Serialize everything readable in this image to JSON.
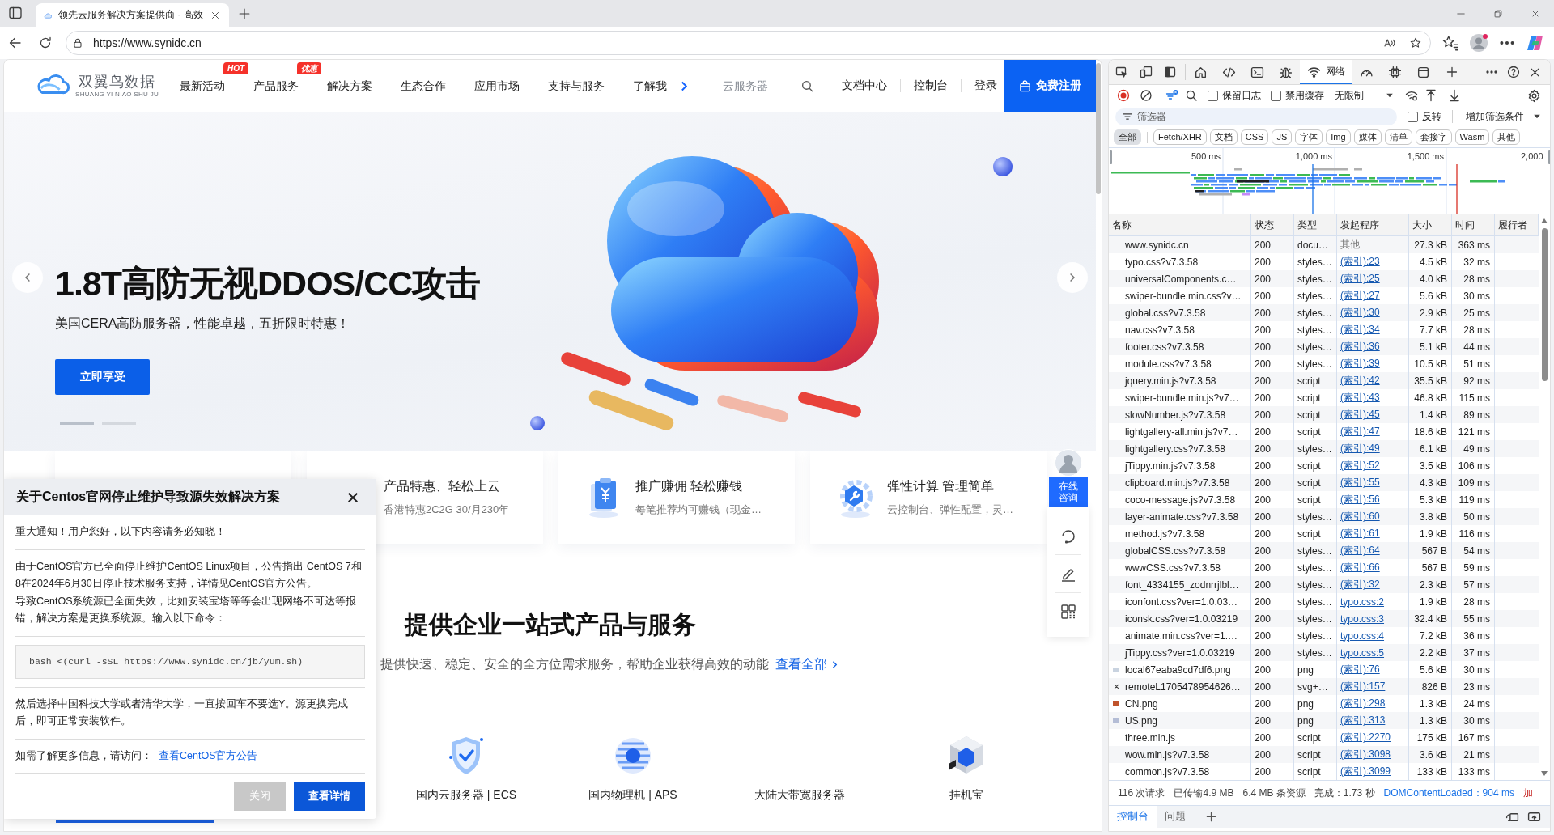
{
  "browser": {
    "tab_title": "领先云服务解决方案提供商 - 高效",
    "url": "https://www.synidc.cn"
  },
  "site": {
    "logo": {
      "name": "双翼鸟数据",
      "tagline": "SHUANG YI NIAO SHU JU"
    },
    "nav": [
      {
        "label": "最新活动",
        "badge": "HOT"
      },
      {
        "label": "产品服务",
        "badge": "优惠"
      },
      {
        "label": "解决方案"
      },
      {
        "label": "生态合作"
      },
      {
        "label": "应用市场"
      },
      {
        "label": "支持与服务"
      },
      {
        "label": "了解我"
      }
    ],
    "search": {
      "placeholder": "云服务器"
    },
    "links": [
      "文档中心",
      "控制台",
      "登录"
    ],
    "register": "免费注册",
    "hero": {
      "title": "1.8T高防无视DDOS/CC攻击",
      "subtitle": "美国CERA高防服务器，性能卓越，五折限时特惠！",
      "button": "立即享受",
      "slides": [
        {
          "selected": true
        },
        {
          "selected": false
        }
      ]
    },
    "features": [
      {
        "kind": "none",
        "title": "产品特惠、轻松上云",
        "text": "香港特惠2C2G 30/月230年"
      },
      {
        "kind": "clipboard",
        "title": "推广赚佣 轻松赚钱",
        "text": "每笔推荐均可赚钱（现金…"
      },
      {
        "kind": "gear",
        "title": "弹性计算 管理简单",
        "text": "云控制台、弹性配置，灵…"
      }
    ],
    "consult": "在线咨询",
    "section": {
      "title": "提供企业一站式产品与服务",
      "subtitle": "提供快速、稳定、安全的全方位需求服务，帮助企业获得高效的动能",
      "link": "查看全部"
    },
    "products": [
      {
        "kind": "shield",
        "label": "国内云服务器 | ECS"
      },
      {
        "kind": "globe",
        "label": "国内物理机 | APS"
      },
      {
        "kind": "none",
        "label": "大陆大带宽服务器"
      },
      {
        "kind": "cube",
        "label": "挂机宝"
      }
    ]
  },
  "popup": {
    "title": "关于Centos官网停止维护导致源失效解决方案",
    "notice": "重大通知！用户您好，以下内容请务必知晓！",
    "paragraphs": [
      "由于CentOS官方已全面停止维护CentOS Linux项目，公告指出 CentOS 7和8在2024年6月30日停止技术服务支持，详情见CentOS官方公告。",
      "导致CentOS系统源已全面失效，比如安装宝塔等等会出现网络不可达等报错，解决方案是更换系统源。输入以下命令："
    ],
    "command": "bash <(curl -sSL https://www.synidc.cn/jb/yum.sh)",
    "note": "然后选择中国科技大学或者清华大学，一直按回车不要选Y。源更换完成后，即可正常安装软件。",
    "more": "如需了解更多信息，请访问：",
    "more_link": "查看CentOS官方公告",
    "buttons": [
      {
        "kind": "secondary",
        "label": "关闭"
      },
      {
        "kind": "primary",
        "label": "查看详情"
      }
    ]
  },
  "devtools": {
    "panel_tabs": [
      {
        "kind": "welcome",
        "selected": false
      },
      {
        "kind": "elements",
        "selected": false
      },
      {
        "kind": "console",
        "selected": false
      },
      {
        "kind": "sources",
        "selected": false
      },
      {
        "kind": "network",
        "label": "网络",
        "selected": true
      },
      {
        "kind": "performance",
        "selected": false
      },
      {
        "kind": "memory",
        "selected": false
      },
      {
        "kind": "application",
        "selected": false
      }
    ],
    "preserve_log": {
      "label": "保留日志",
      "checked": false
    },
    "disable_cache": {
      "label": "禁用缓存",
      "checked": false
    },
    "throttling": "无限制",
    "filter": {
      "placeholder": "筛选器"
    },
    "invert": {
      "label": "反转",
      "checked": false
    },
    "more_filters": "增加筛选条件",
    "type_filters": [
      {
        "label": "全部",
        "selected": true
      },
      {
        "label": "Fetch/XHR",
        "selected": false
      },
      {
        "label": "文档",
        "selected": false
      },
      {
        "label": "CSS",
        "selected": false
      },
      {
        "label": "JS",
        "selected": false
      },
      {
        "label": "字体",
        "selected": false
      },
      {
        "label": "Img",
        "selected": false
      },
      {
        "label": "媒体",
        "selected": false
      },
      {
        "label": "清单",
        "selected": false
      },
      {
        "label": "套接字",
        "selected": false
      },
      {
        "label": "Wasm",
        "selected": false
      },
      {
        "label": "其他",
        "selected": false
      }
    ],
    "overview_ticks": [
      "500 ms",
      "1,000 ms",
      "1,500 ms",
      "2,000"
    ],
    "columns": [
      "名称",
      "状态",
      "类型",
      "发起程序",
      "大小",
      "时间",
      "履行者"
    ],
    "rows": [
      {
        "kind": "plain",
        "name": "www.synidc.cn",
        "status": "200",
        "type": "docu…",
        "initiator": "其他",
        "initiator_link": false,
        "size": "27.3 kB",
        "time": "363 ms"
      },
      {
        "kind": "plain",
        "name": "typo.css?v7.3.58",
        "status": "200",
        "type": "styles…",
        "initiator": "(索引):23",
        "initiator_link": true,
        "size": "4.5 kB",
        "time": "32 ms"
      },
      {
        "kind": "plain",
        "name": "universalComponents.c…",
        "status": "200",
        "type": "styles…",
        "initiator": "(索引):25",
        "initiator_link": true,
        "size": "4.0 kB",
        "time": "28 ms"
      },
      {
        "kind": "plain",
        "name": "swiper-bundle.min.css?v…",
        "status": "200",
        "type": "styles…",
        "initiator": "(索引):27",
        "initiator_link": true,
        "size": "5.6 kB",
        "time": "30 ms"
      },
      {
        "kind": "plain",
        "name": "global.css?v7.3.58",
        "status": "200",
        "type": "styles…",
        "initiator": "(索引):30",
        "initiator_link": true,
        "size": "2.9 kB",
        "time": "25 ms"
      },
      {
        "kind": "plain",
        "name": "nav.css?v7.3.58",
        "status": "200",
        "type": "styles…",
        "initiator": "(索引):34",
        "initiator_link": true,
        "size": "7.7 kB",
        "time": "28 ms"
      },
      {
        "kind": "plain",
        "name": "footer.css?v7.3.58",
        "status": "200",
        "type": "styles…",
        "initiator": "(索引):36",
        "initiator_link": true,
        "size": "5.1 kB",
        "time": "44 ms"
      },
      {
        "kind": "plain",
        "name": "module.css?v7.3.58",
        "status": "200",
        "type": "styles…",
        "initiator": "(索引):39",
        "initiator_link": true,
        "size": "10.5 kB",
        "time": "51 ms"
      },
      {
        "kind": "plain",
        "name": "jquery.min.js?v7.3.58",
        "status": "200",
        "type": "script",
        "initiator": "(索引):42",
        "initiator_link": true,
        "size": "35.5 kB",
        "time": "92 ms"
      },
      {
        "kind": "plain",
        "name": "swiper-bundle.min.js?v7…",
        "status": "200",
        "type": "script",
        "initiator": "(索引):43",
        "initiator_link": true,
        "size": "46.8 kB",
        "time": "115 ms"
      },
      {
        "kind": "plain",
        "name": "slowNumber.js?v7.3.58",
        "status": "200",
        "type": "script",
        "initiator": "(索引):45",
        "initiator_link": true,
        "size": "1.4 kB",
        "time": "89 ms"
      },
      {
        "kind": "plain",
        "name": "lightgallery-all.min.js?v7…",
        "status": "200",
        "type": "script",
        "initiator": "(索引):47",
        "initiator_link": true,
        "size": "18.6 kB",
        "time": "121 ms"
      },
      {
        "kind": "plain",
        "name": "lightgallery.css?v7.3.58",
        "status": "200",
        "type": "styles…",
        "initiator": "(索引):49",
        "initiator_link": true,
        "size": "6.1 kB",
        "time": "49 ms"
      },
      {
        "kind": "plain",
        "name": "jTippy.min.js?v7.3.58",
        "status": "200",
        "type": "script",
        "initiator": "(索引):52",
        "initiator_link": true,
        "size": "3.5 kB",
        "time": "106 ms"
      },
      {
        "kind": "plain",
        "name": "clipboard.min.js?v7.3.58",
        "status": "200",
        "type": "script",
        "initiator": "(索引):55",
        "initiator_link": true,
        "size": "4.3 kB",
        "time": "109 ms"
      },
      {
        "kind": "plain",
        "name": "coco-message.js?v7.3.58",
        "status": "200",
        "type": "script",
        "initiator": "(索引):56",
        "initiator_link": true,
        "size": "5.3 kB",
        "time": "119 ms"
      },
      {
        "kind": "plain",
        "name": "layer-animate.css?v7.3.58",
        "status": "200",
        "type": "styles…",
        "initiator": "(索引):60",
        "initiator_link": true,
        "size": "3.8 kB",
        "time": "50 ms"
      },
      {
        "kind": "plain",
        "name": "method.js?v7.3.58",
        "status": "200",
        "type": "script",
        "initiator": "(索引):61",
        "initiator_link": true,
        "size": "1.9 kB",
        "time": "116 ms"
      },
      {
        "kind": "plain",
        "name": "globalCSS.css?v7.3.58",
        "status": "200",
        "type": "styles…",
        "initiator": "(索引):64",
        "initiator_link": true,
        "size": "567 B",
        "time": "54 ms"
      },
      {
        "kind": "plain",
        "name": "wwwCSS.css?v7.3.58",
        "status": "200",
        "type": "styles…",
        "initiator": "(索引):66",
        "initiator_link": true,
        "size": "567 B",
        "time": "59 ms"
      },
      {
        "kind": "plain",
        "name": "font_4334155_zodnrrjlbl…",
        "status": "200",
        "type": "styles…",
        "initiator": "(索引):32",
        "initiator_link": true,
        "size": "2.3 kB",
        "time": "57 ms"
      },
      {
        "kind": "plain",
        "name": "iconfont.css?ver=1.0.03…",
        "status": "200",
        "type": "styles…",
        "initiator": "typo.css:2",
        "initiator_link": true,
        "size": "1.9 kB",
        "time": "28 ms"
      },
      {
        "kind": "plain",
        "name": "iconsk.css?ver=1.0.03219",
        "status": "200",
        "type": "styles…",
        "initiator": "typo.css:3",
        "initiator_link": true,
        "size": "32.4 kB",
        "time": "55 ms"
      },
      {
        "kind": "plain",
        "name": "animate.min.css?ver=1.…",
        "status": "200",
        "type": "styles…",
        "initiator": "typo.css:4",
        "initiator_link": true,
        "size": "7.2 kB",
        "time": "36 ms"
      },
      {
        "kind": "plain",
        "name": "jTippy.css?ver=1.0.03219",
        "status": "200",
        "type": "styles…",
        "initiator": "typo.css:5",
        "initiator_link": true,
        "size": "2.2 kB",
        "time": "37 ms"
      },
      {
        "kind": "image",
        "color": "#c9d3e0",
        "name": "local67eaba9cd7df6.png",
        "status": "200",
        "type": "png",
        "initiator": "(索引):76",
        "initiator_link": true,
        "size": "5.6 kB",
        "time": "30 ms"
      },
      {
        "kind": "svg",
        "name": "remoteL1705478954626…",
        "status": "200",
        "type": "svg+…",
        "initiator": "(索引):157",
        "initiator_link": true,
        "size": "826 B",
        "time": "23 ms"
      },
      {
        "kind": "image",
        "color": "#c0532b",
        "name": "CN.png",
        "status": "200",
        "type": "png",
        "initiator": "(索引):298",
        "initiator_link": true,
        "size": "1.3 kB",
        "time": "24 ms"
      },
      {
        "kind": "image",
        "color": "#b4bdd6",
        "name": "US.png",
        "status": "200",
        "type": "png",
        "initiator": "(索引):313",
        "initiator_link": true,
        "size": "1.3 kB",
        "time": "30 ms"
      },
      {
        "kind": "plain",
        "name": "three.min.js",
        "status": "200",
        "type": "script",
        "initiator": "(索引):2270",
        "initiator_link": true,
        "size": "175 kB",
        "time": "167 ms"
      },
      {
        "kind": "plain",
        "name": "wow.min.js?v7.3.58",
        "status": "200",
        "type": "script",
        "initiator": "(索引):3098",
        "initiator_link": true,
        "size": "3.6 kB",
        "time": "21 ms"
      },
      {
        "kind": "plain",
        "name": "common.js?v7.3.58",
        "status": "200",
        "type": "script",
        "initiator": "(索引):3099",
        "initiator_link": true,
        "size": "133 kB",
        "time": "133 ms"
      }
    ],
    "summary": [
      {
        "kind": "plain",
        "text": "116 次请求"
      },
      {
        "kind": "plain",
        "text": "已传输4.9 MB"
      },
      {
        "kind": "plain",
        "text": "6.4 MB 条资源"
      },
      {
        "kind": "plain",
        "text": "完成：1.73 秒"
      },
      {
        "kind": "dom",
        "text": "DOMContentLoaded：904 ms"
      },
      {
        "kind": "load",
        "text": "加"
      }
    ],
    "drawer_tabs": [
      {
        "label": "控制台",
        "selected": true
      },
      {
        "label": "问题",
        "selected": false
      }
    ]
  }
}
